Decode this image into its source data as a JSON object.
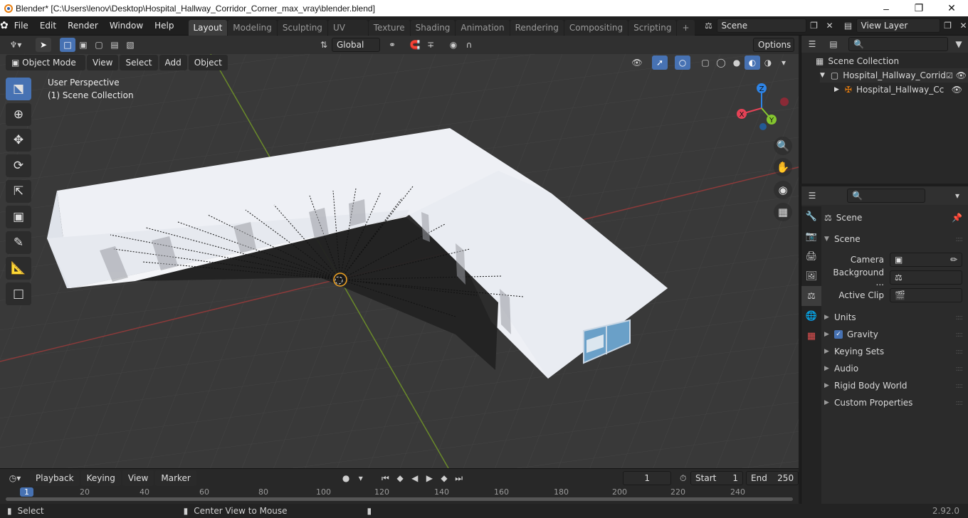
{
  "titlebar": {
    "title": "Blender* [C:\\Users\\lenov\\Desktop\\Hospital_Hallway_Corridor_Corner_max_vray\\blender.blend]",
    "minimize_icon": "minimize-icon",
    "maximize_icon": "restore-icon",
    "close_icon": "close-icon"
  },
  "menubar": {
    "items": [
      "File",
      "Edit",
      "Render",
      "Window",
      "Help"
    ]
  },
  "workspaces": {
    "tabs": [
      "Layout",
      "Modeling",
      "Sculpting",
      "UV Editing",
      "Texture Paint",
      "Shading",
      "Animation",
      "Rendering",
      "Compositing",
      "Scripting"
    ],
    "active": "Layout"
  },
  "scene_selector": {
    "value": "Scene"
  },
  "viewlayer_selector": {
    "value": "View Layer"
  },
  "viewport_header": {
    "transform_orientation": "Global",
    "options_label": "Options",
    "mode": "Object Mode",
    "menus": [
      "View",
      "Select",
      "Add",
      "Object"
    ]
  },
  "viewport": {
    "perspective_label": "User Perspective",
    "collection_label": "(1) Scene Collection",
    "gizmo_axes": [
      "Z",
      "X",
      "Y"
    ],
    "axis_colors": {
      "x": "#e54256",
      "y": "#84c52f",
      "z": "#2e84e6"
    }
  },
  "timeline": {
    "menus": [
      "Playback",
      "Keying",
      "View",
      "Marker"
    ],
    "current_frame": "1",
    "start_label": "Start",
    "start_value": "1",
    "end_label": "End",
    "end_value": "250",
    "ruler": [
      "1",
      "20",
      "40",
      "60",
      "80",
      "100",
      "120",
      "140",
      "160",
      "180",
      "200",
      "220",
      "240"
    ]
  },
  "outliner": {
    "root": "Scene Collection",
    "items": [
      {
        "label": "Hospital_Hallway_Corrid",
        "level": 1
      },
      {
        "label": "Hospital_Hallway_Cc",
        "level": 2
      }
    ]
  },
  "properties": {
    "header": "Scene",
    "panel_title": "Scene",
    "fields": [
      {
        "label": "Camera",
        "value": ""
      },
      {
        "label": "Background ...",
        "value": ""
      },
      {
        "label": "Active Clip",
        "value": ""
      }
    ],
    "subpanels": [
      "Units",
      "Gravity",
      "Keying Sets",
      "Audio",
      "Rigid Body World",
      "Custom Properties"
    ],
    "gravity_checked": true
  },
  "statusbar": {
    "left_hint": "Select",
    "middle_hint": "Center View to Mouse",
    "version": "2.92.0"
  }
}
